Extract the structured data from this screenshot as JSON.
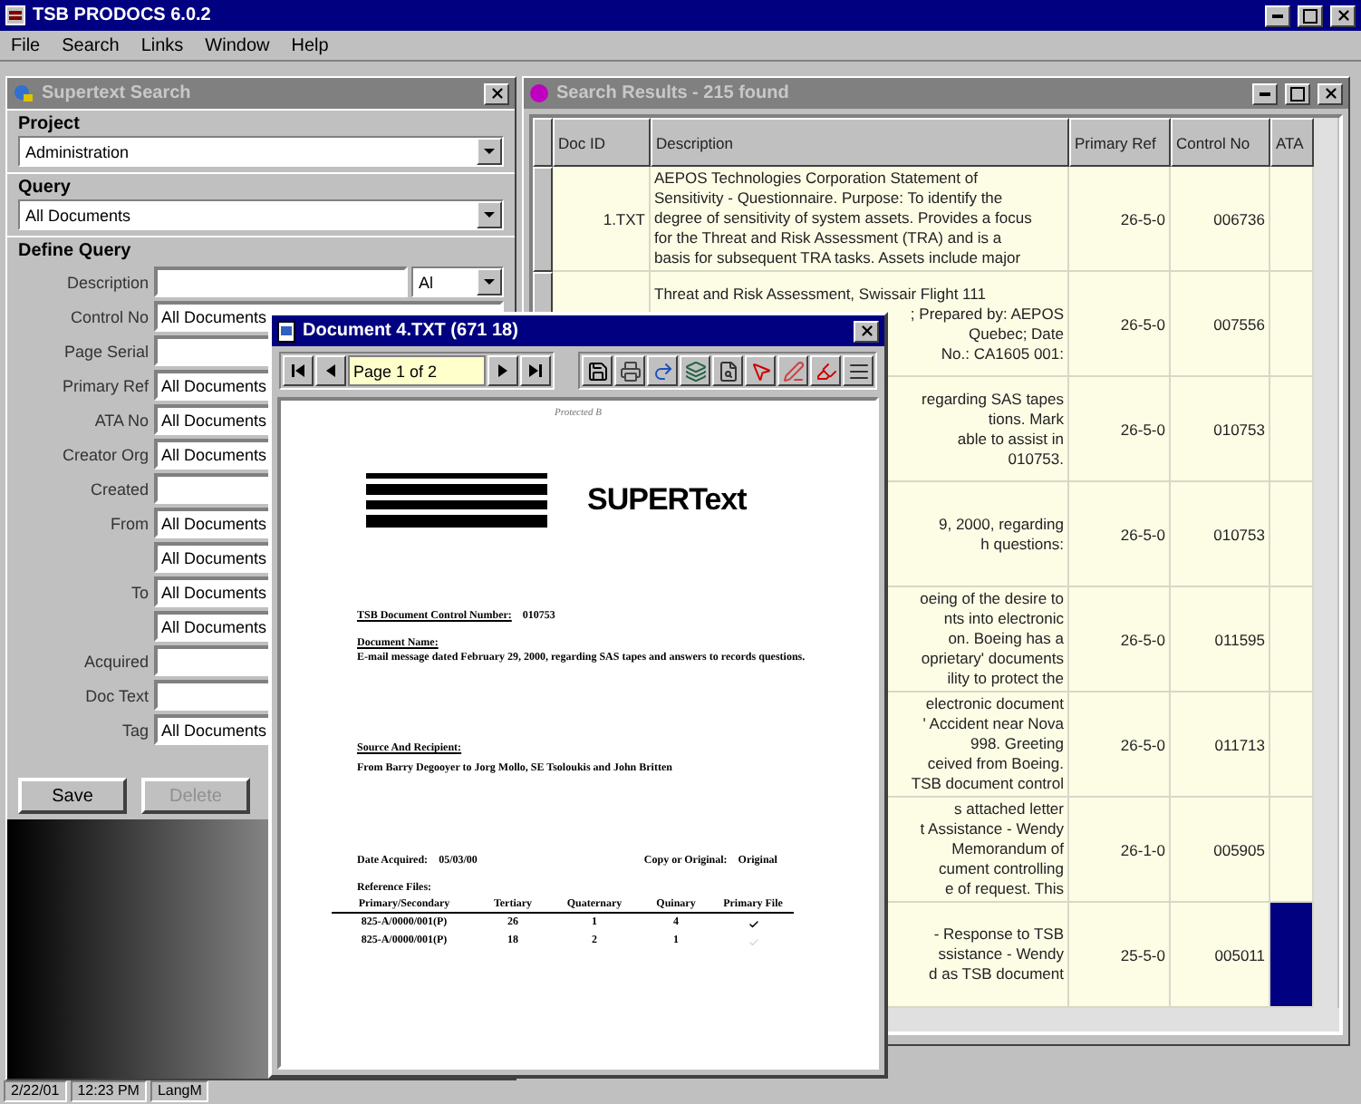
{
  "app": {
    "title": "TSB PRODOCS 6.0.2",
    "menu": [
      "File",
      "Search",
      "Links",
      "Window",
      "Help"
    ]
  },
  "search_panel": {
    "title": "Supertext Search",
    "project_label": "Project",
    "project": "Administration",
    "query_label": "Query",
    "query": "All Documents",
    "define_label": "Define Query",
    "fields": [
      {
        "label": "Description",
        "kind": "combo_text",
        "combo": "Al"
      },
      {
        "label": "Control No",
        "value": "All Documents",
        "kind": "text"
      },
      {
        "label": "Page Serial",
        "kind": "text"
      },
      {
        "label": "Primary Ref",
        "value": "All Documents",
        "kind": "text"
      },
      {
        "label": "ATA No",
        "value": "All Documents",
        "kind": "text"
      },
      {
        "label": "Creator Org",
        "value": "All Documents",
        "kind": "text"
      },
      {
        "label": "Created",
        "kind": "text"
      },
      {
        "label": "From",
        "value": "All Documents",
        "kind": "text"
      },
      {
        "value": "All Documents",
        "kind": "text"
      },
      {
        "label": "To",
        "value": "All Documents",
        "kind": "text"
      },
      {
        "value": "All Documents",
        "kind": "text"
      },
      {
        "label": "Acquired",
        "kind": "text"
      },
      {
        "label": "Doc Text",
        "kind": "text"
      },
      {
        "label": "Tag",
        "value": "All Documents",
        "kind": "text"
      }
    ],
    "buttons": [
      {
        "label": "Save",
        "disabled": false
      },
      {
        "label": "Delete",
        "disabled": true
      }
    ]
  },
  "results": {
    "title": "Search Results - 215 found",
    "columns": [
      "Doc ID",
      "Description",
      "Primary Ref",
      "Control No",
      "ATA"
    ],
    "rows": [
      {
        "doc_id": "1.TXT",
        "lines": [
          {
            "text": "AEPOS Technologies Corporation Statement of",
            "clipped": false
          },
          {
            "text": "Sensitivity - Questionnaire. Purpose: To identify the",
            "clipped": false
          },
          {
            "text": "degree of sensitivity of system assets. Provides a focus",
            "clipped": false
          },
          {
            "text": "for the Threat and Risk Assessment (TRA) and is a",
            "clipped": false
          },
          {
            "text": "basis for subsequent TRA tasks. Assets include major",
            "clipped": false
          }
        ],
        "primary_ref": "26-5-0",
        "control_no": "006736",
        "selected": false
      },
      {
        "lines": [
          {
            "text": "Threat and Risk Assessment, Swissair Flight 111",
            "clipped": false
          },
          {
            "text": "; Prepared by: AEPOS",
            "clipped": true
          },
          {
            "text": "Quebec; Date",
            "clipped": true
          },
          {
            "text": "No.: CA1605 001:",
            "clipped": true
          }
        ],
        "primary_ref": "26-5-0",
        "control_no": "007556",
        "selected": false
      },
      {
        "lines": [
          {
            "text": "regarding SAS tapes",
            "clipped": true
          },
          {
            "text": "tions. Mark",
            "clipped": true
          },
          {
            "text": "able to assist in",
            "clipped": true
          },
          {
            "text": "010753.",
            "clipped": true
          }
        ],
        "primary_ref": "26-5-0",
        "control_no": "010753",
        "selected": false
      },
      {
        "lines": [
          {
            "text": "9, 2000, regarding",
            "clipped": true
          },
          {
            "text": "h questions:",
            "clipped": true
          }
        ],
        "primary_ref": "26-5-0",
        "control_no": "010753",
        "selected": false
      },
      {
        "lines": [
          {
            "text": "oeing of the desire to",
            "clipped": true
          },
          {
            "text": "nts into electronic",
            "clipped": true
          },
          {
            "text": "on. Boeing has a",
            "clipped": true
          },
          {
            "text": "oprietary' documents",
            "clipped": true
          },
          {
            "text": "ility to protect the",
            "clipped": true
          }
        ],
        "primary_ref": "26-5-0",
        "control_no": "011595",
        "selected": false
      },
      {
        "lines": [
          {
            "text": "electronic document",
            "clipped": true
          },
          {
            "text": "' Accident near Nova",
            "clipped": true
          },
          {
            "text": "998. Greeting",
            "clipped": true
          },
          {
            "text": "ceived from Boeing.",
            "clipped": true
          },
          {
            "text": "TSB document control",
            "clipped": true
          }
        ],
        "primary_ref": "26-5-0",
        "control_no": "011713",
        "selected": false
      },
      {
        "lines": [
          {
            "text": "s attached letter",
            "clipped": true
          },
          {
            "text": "t Assistance - Wendy",
            "clipped": true
          },
          {
            "text": "Memorandum of",
            "clipped": true
          },
          {
            "text": "cument controlling",
            "clipped": true
          },
          {
            "text": "e of request. This",
            "clipped": true
          }
        ],
        "primary_ref": "26-1-0",
        "control_no": "005905",
        "selected": false
      },
      {
        "lines": [
          {
            "text": "- Response to TSB",
            "clipped": true
          },
          {
            "text": "ssistance - Wendy",
            "clipped": true
          },
          {
            "text": "d as TSB document",
            "clipped": true
          }
        ],
        "primary_ref": "25-5-0",
        "control_no": "005011",
        "selected": true
      }
    ]
  },
  "document_window": {
    "title": "Document 4.TXT (671 18)",
    "page": "Page 1 of 2",
    "header_note": "Protected B",
    "logo": "SUPERText",
    "control_label": "TSB Document Control Number:",
    "control_number": "010753",
    "name_label": "Document Name:",
    "name": "E-mail message dated February 29, 2000, regarding SAS tapes and answers to records questions.",
    "source_label": "Source And Recipient:",
    "source": "From Barry Degooyer to Jorg Mollo, SE Tsoloukis and John Britten",
    "acquired_label": "Date Acquired:",
    "acquired": "05/03/00",
    "copy_label": "Copy or Original:",
    "copy": "Original",
    "references_label": "Reference Files:",
    "ref_columns": [
      "Primary/Secondary",
      "Tertiary",
      "Quaternary",
      "Quinary",
      "Primary File"
    ],
    "ref_rows": [
      {
        "cells": [
          "825-A/0000/001(P)",
          "26",
          "1",
          "4"
        ],
        "primary": true
      },
      {
        "cells": [
          "825-A/0000/001(P)",
          "18",
          "2",
          "1"
        ],
        "primary": false
      }
    ]
  },
  "status_bar": [
    "2/22/01",
    "12:23 PM",
    "LangM"
  ]
}
